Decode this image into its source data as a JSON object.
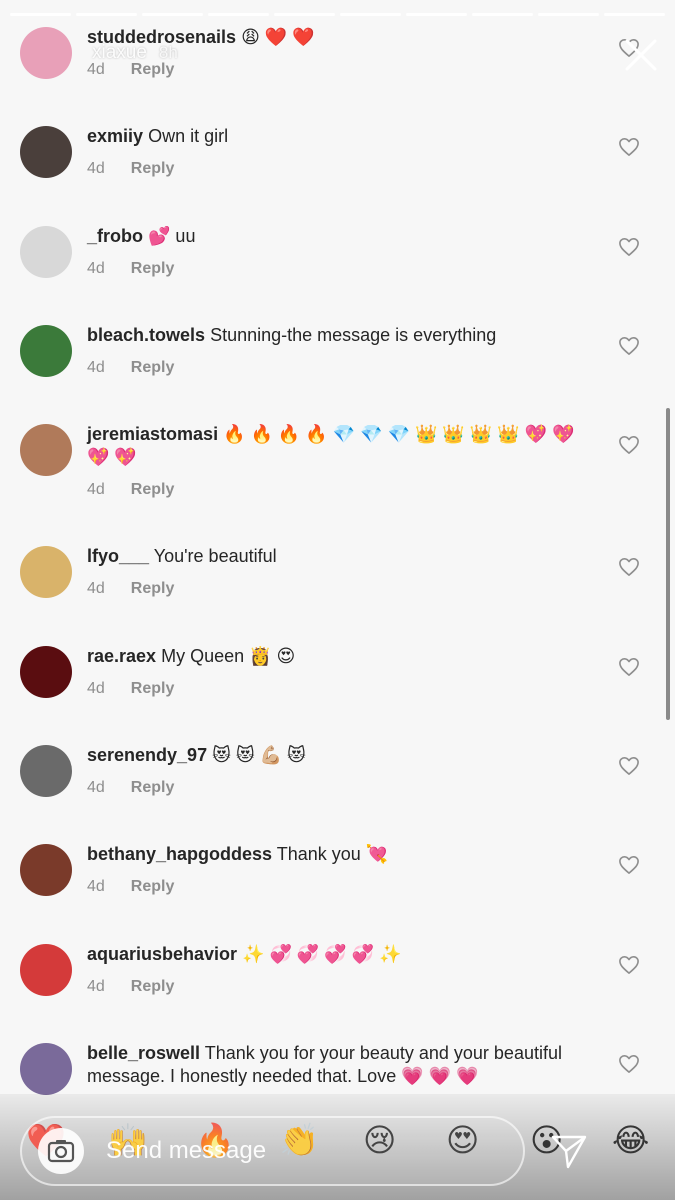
{
  "story": {
    "owner": "xiaxue",
    "time_ago": "8h",
    "progress_segments": 10,
    "progress_done": 10
  },
  "comments": [
    {
      "user": "studdedrosenails",
      "text": "😩 ❤️ ❤️",
      "time": "4d",
      "reply": "Reply",
      "avatar_color": "#e8a0b8"
    },
    {
      "user": "exmiiy",
      "text": "Own it girl",
      "time": "4d",
      "reply": "Reply",
      "avatar_color": "#4a3f3b"
    },
    {
      "user": "_frobo",
      "text": "💕 uu",
      "time": "4d",
      "reply": "Reply",
      "avatar_color": "#d8d8d8"
    },
    {
      "user": "bleach.towels",
      "text": "Stunning-the message is everything",
      "time": "4d",
      "reply": "Reply",
      "avatar_color": "#3b7a3a"
    },
    {
      "user": "jeremiastomasi",
      "text": "🔥 🔥 🔥 🔥 💎 💎 💎 👑 👑 👑 👑 💖 💖 💖 💖",
      "time": "4d",
      "reply": "Reply",
      "avatar_color": "#b07a5a"
    },
    {
      "user": "lfyo___",
      "text": "You're beautiful",
      "time": "4d",
      "reply": "Reply",
      "avatar_color": "#d9b36a"
    },
    {
      "user": "rae.raex",
      "text": "My Queen 👸 😍",
      "time": "4d",
      "reply": "Reply",
      "avatar_color": "#5a0d10"
    },
    {
      "user": "serenendy_97",
      "text": "😻 😻 💪🏼 😻",
      "time": "4d",
      "reply": "Reply",
      "avatar_color": "#6a6a6a"
    },
    {
      "user": "bethany_hapgoddess",
      "text": "Thank you 💘",
      "time": "4d",
      "reply": "Reply",
      "avatar_color": "#7a3a2a"
    },
    {
      "user": "aquariusbehavior",
      "text": "✨ 💞 💞 💞 💞 ✨",
      "time": "4d",
      "reply": "Reply",
      "avatar_color": "#d43a3a"
    },
    {
      "user": "belle_roswell",
      "text": "Thank you for your beauty and your beautiful message.  I honestly needed that. Love 💗 💗 💗",
      "time": "",
      "reply": "",
      "avatar_color": "#7a6a9a"
    }
  ],
  "quick_reactions": [
    "❤️",
    "🙌",
    "🔥",
    "👏",
    "😢",
    "😍",
    "😮",
    "😂"
  ],
  "message_bar": {
    "placeholder": "Send message"
  },
  "colors": {
    "background": "#f7f7f7",
    "username": "#262626",
    "meta": "#8e8e8e"
  }
}
